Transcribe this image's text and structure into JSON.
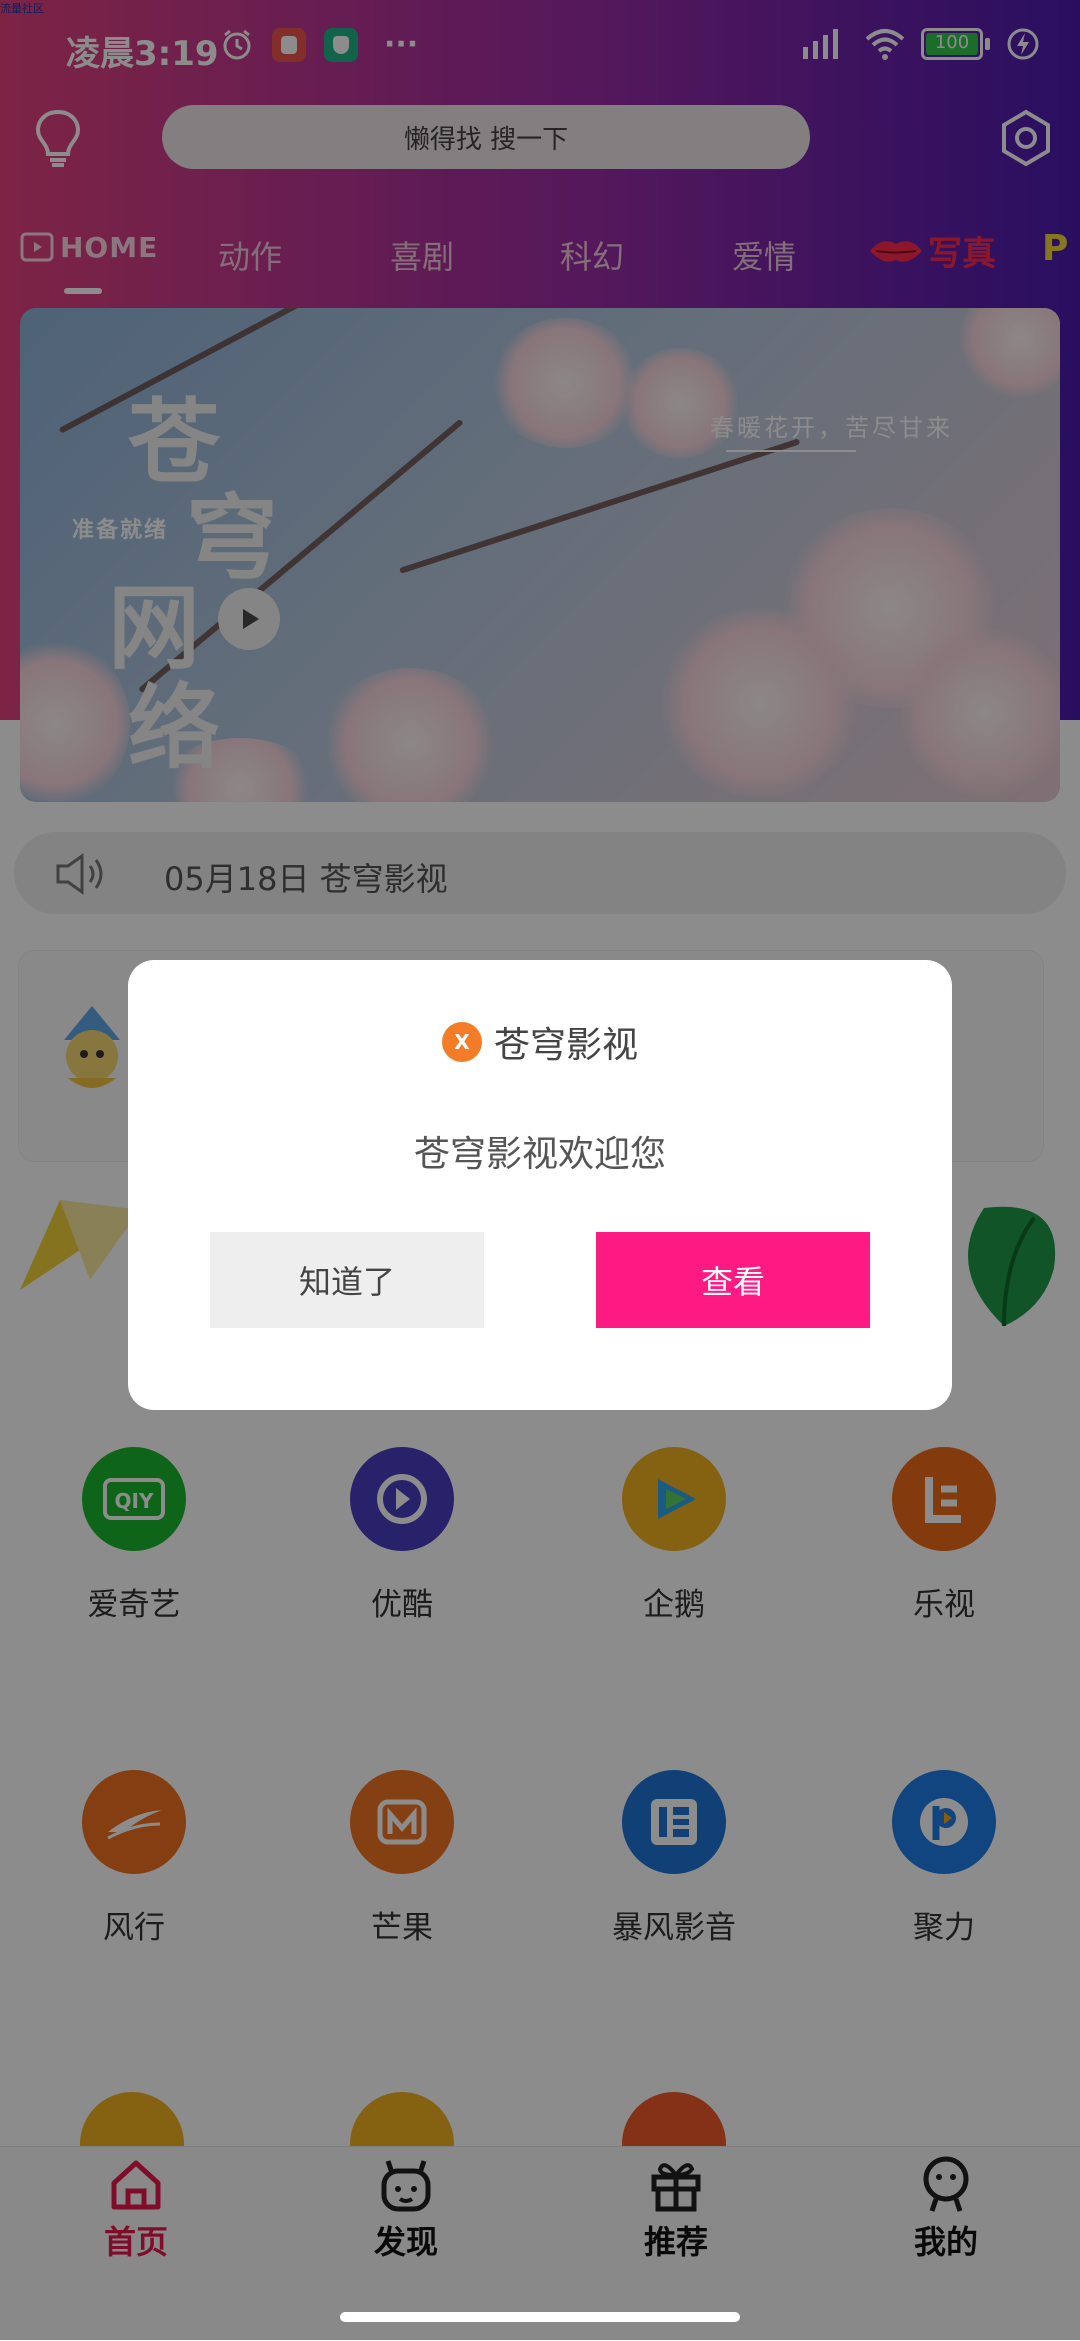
{
  "status_bar": {
    "tiny_label": "流量社区",
    "time": "凌晨3:19",
    "more": "···",
    "battery": "100"
  },
  "search": {
    "placeholder": "懒得找 搜一下"
  },
  "tabs": {
    "home": "HOME",
    "items": [
      "动作",
      "喜剧",
      "科幻",
      "爱情"
    ],
    "photo": "写真",
    "p": "P"
  },
  "banner": {
    "title_chars": [
      "苍",
      "穹",
      "网",
      "络"
    ],
    "ready": "准备就绪",
    "slogan": "春暖花开，苦尽甘来"
  },
  "notice": {
    "text": "05月18日 苍穹影视"
  },
  "apps": [
    {
      "label": "爱奇艺",
      "color": "#1bb72e",
      "icon": "iqiyi-icon"
    },
    {
      "label": "优酷",
      "color": "#4a3fc2",
      "icon": "youku-icon"
    },
    {
      "label": "企鹅",
      "color": "#f0b321",
      "icon": "tencent-video-icon"
    },
    {
      "label": "乐视",
      "color": "#ef6b18",
      "icon": "letv-icon"
    },
    {
      "label": "风行",
      "color": "#f0711f",
      "icon": "funshion-icon"
    },
    {
      "label": "芒果",
      "color": "#f07523",
      "icon": "mango-icon"
    },
    {
      "label": "暴风影音",
      "color": "#1e75d6",
      "icon": "baofeng-icon"
    },
    {
      "label": "聚力",
      "color": "#1f7ee8",
      "icon": "pptv-icon"
    }
  ],
  "bottom_nav": [
    {
      "label": "首页",
      "icon": "home-icon",
      "active": true
    },
    {
      "label": "发现",
      "icon": "discover-icon",
      "active": false
    },
    {
      "label": "推荐",
      "icon": "gift-icon",
      "active": false
    },
    {
      "label": "我的",
      "icon": "profile-icon",
      "active": false
    }
  ],
  "dialog": {
    "logo": "X",
    "title": "苍穹影视",
    "message": "苍穹影视欢迎您",
    "dismiss_label": "知道了",
    "view_label": "查看"
  },
  "colors": {
    "accent": "#fe1983",
    "nav_active": "#e7194e"
  }
}
